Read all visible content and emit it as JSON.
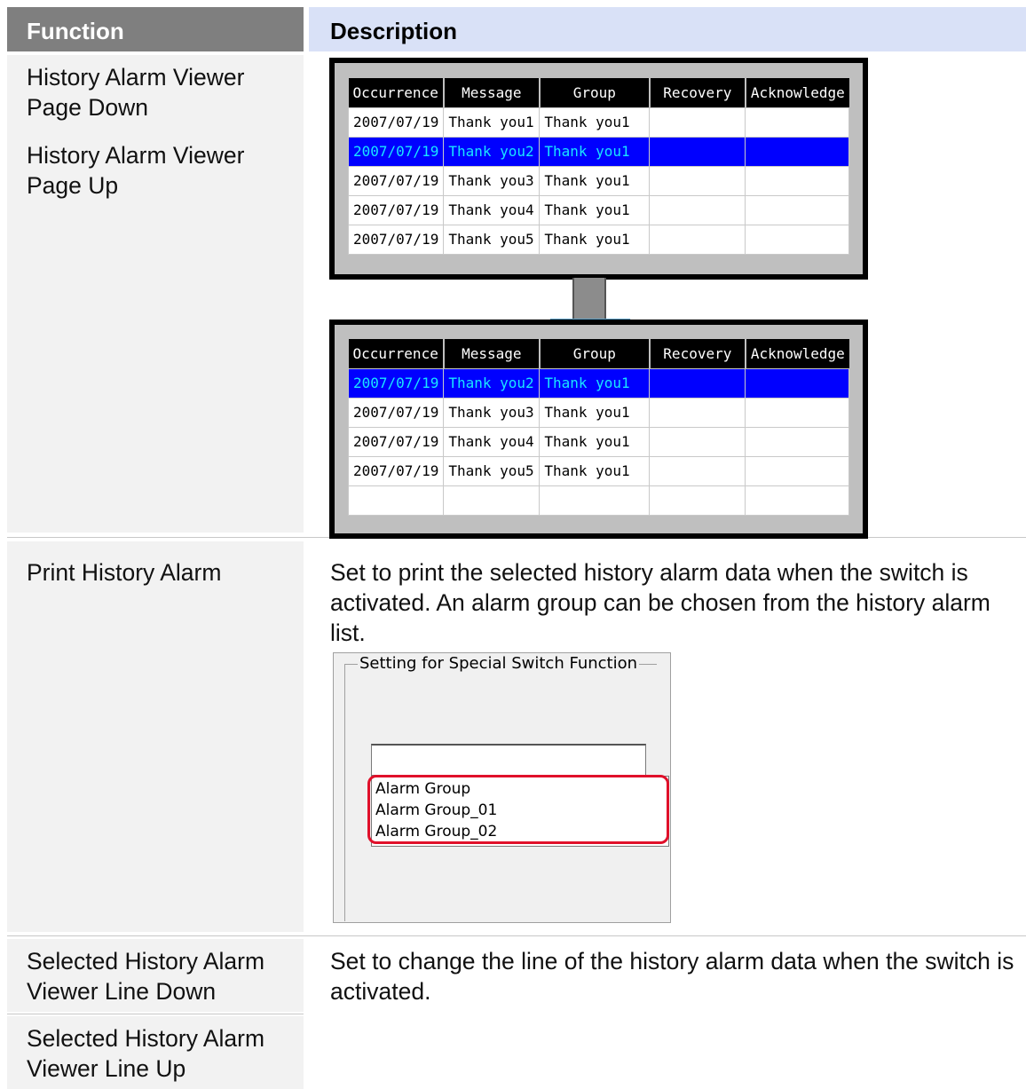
{
  "header": {
    "function_label": "Function",
    "description_label": "Description"
  },
  "rows": [
    {
      "function_lines": [
        "History Alarm Viewer",
        "Page Down"
      ]
    },
    {
      "function_lines": [
        "History Alarm Viewer",
        "Page Up"
      ]
    },
    {
      "function_lines": [
        "Print History Alarm"
      ],
      "description": "Set to print the selected history alarm data when the switch is activated. An alarm group can be chosen from the history alarm list."
    },
    {
      "function_lines": [
        "Selected History Alarm",
        "Viewer Line Down"
      ],
      "description": "Set to change the line of the history alarm data when the switch is activated."
    },
    {
      "function_lines": [
        "Selected History Alarm",
        "Viewer Line Up"
      ]
    }
  ],
  "viewer_columns": [
    "Occurrence",
    "Message",
    "Group",
    "Recovery",
    "Acknowledge"
  ],
  "viewer_before": [
    [
      "2007/07/19",
      "Thank you1",
      "Thank you1",
      "",
      ""
    ],
    [
      "2007/07/19",
      "Thank you2",
      "Thank you1",
      "",
      ""
    ],
    [
      "2007/07/19",
      "Thank you3",
      "Thank you1",
      "",
      ""
    ],
    [
      "2007/07/19",
      "Thank you4",
      "Thank you1",
      "",
      ""
    ],
    [
      "2007/07/19",
      "Thank you5",
      "Thank you1",
      "",
      ""
    ]
  ],
  "viewer_before_selected": 1,
  "viewer_after": [
    [
      "2007/07/19",
      "Thank you2",
      "Thank you1",
      "",
      ""
    ],
    [
      "2007/07/19",
      "Thank you3",
      "Thank you1",
      "",
      ""
    ],
    [
      "2007/07/19",
      "Thank you4",
      "Thank you1",
      "",
      ""
    ],
    [
      "2007/07/19",
      "Thank you5",
      "Thank you1",
      "",
      ""
    ],
    [
      "",
      "",
      "",
      "",
      ""
    ]
  ],
  "viewer_after_selected": 0,
  "dialog": {
    "group_label": "Setting for Special Switch Function",
    "combo_value": "",
    "options": [
      "Alarm Group",
      "Alarm Group_01",
      "Alarm Group_02"
    ]
  },
  "colors": {
    "header_function_bg": "#7f7f7f",
    "header_description_bg": "#d9e1f7",
    "function_cell_bg": "#f2f2f2",
    "selected_row_bg": "#0000ff",
    "selected_row_text": "#19e6ff",
    "highlight_border": "#e0102a"
  }
}
